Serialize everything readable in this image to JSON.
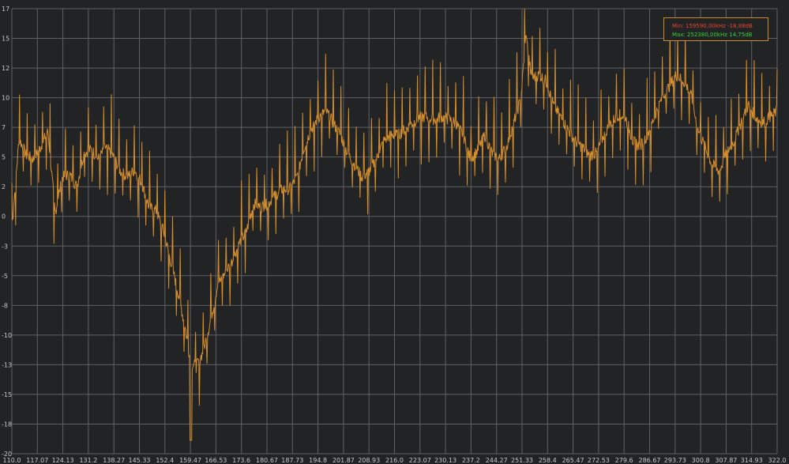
{
  "chart_data": {
    "type": "line",
    "xlim": [
      110.0,
      322.0
    ],
    "ylim": [
      -20,
      17
    ],
    "grid": true,
    "colors": {
      "background": "#222325",
      "grid": "#5f6166",
      "line": "#d8902c",
      "min_text": "#e8442a",
      "max_text": "#39d33a"
    },
    "x_tick_labels": [
      "110.0",
      "117.07",
      "124.13",
      "131.2",
      "138.27",
      "145.33",
      "152.4",
      "159.47",
      "166.53",
      "173.6",
      "180.67",
      "187.73",
      "194.8",
      "201.87",
      "208.93",
      "216.0",
      "223.07",
      "230.13",
      "237.2",
      "244.27",
      "251.33",
      "258.4",
      "265.47",
      "272.53",
      "279.6",
      "286.67",
      "293.73",
      "300.8",
      "307.87",
      "314.93",
      "322.0"
    ],
    "y_tick_labels": [
      "17",
      "15",
      "12",
      "10",
      "7",
      "5",
      "2",
      "0",
      "-3",
      "-5",
      "-8",
      "-10",
      "-13",
      "-15",
      "-18",
      "-20"
    ],
    "min_label": "Min: 159590,00kHz -18,88dB",
    "max_label": "Max: 252380,00kHz 14,75dB",
    "series": [
      {
        "values_x": [
          110.0,
          112.0,
          114.0,
          116.0,
          118.0,
          120.0,
          122.0,
          124.0,
          126.0,
          128.0,
          130.0,
          132.0,
          134.0,
          136.0,
          138.0,
          140.0,
          142.0,
          144.0,
          146.0,
          148.0,
          150.0,
          152.0,
          154.0,
          156.0,
          158.0,
          159.6,
          161.0,
          163.0,
          165.0,
          167.0,
          169.0,
          171.0,
          173.0,
          175.0,
          177.0,
          179.0,
          181.0,
          183.0,
          185.0,
          187.0,
          189.0,
          191.0,
          193.0,
          195.0,
          197.0,
          199.0,
          201.0,
          203.0,
          205.0,
          207.0,
          209.0,
          211.0,
          213.0,
          215.0,
          217.0,
          219.0,
          221.0,
          223.0,
          225.0,
          227.0,
          229.0,
          231.0,
          233.0,
          235.0,
          237.0,
          239.0,
          241.0,
          243.0,
          245.0,
          247.0,
          249.0,
          251.0,
          252.4,
          254.0,
          256.0,
          258.0,
          260.0,
          262.0,
          264.0,
          266.0,
          268.0,
          270.0,
          272.0,
          274.0,
          276.0,
          278.0,
          280.0,
          282.0,
          284.0,
          286.0,
          288.0,
          290.0,
          292.0,
          294.0,
          296.0,
          298.0,
          300.0,
          302.0,
          304.0,
          306.0,
          308.0,
          310.0,
          312.0,
          314.0,
          316.0,
          318.0,
          320.0,
          322.0
        ],
        "values_y": [
          -1.2,
          6.2,
          4.8,
          4.5,
          5.5,
          6.8,
          0.0,
          3.0,
          3.2,
          2.2,
          5.0,
          5.3,
          4.5,
          5.5,
          4.8,
          3.5,
          3.0,
          3.6,
          2.5,
          0.5,
          0.2,
          -1.5,
          -4.0,
          -6.5,
          -9.5,
          -12.5,
          -12.8,
          -11.5,
          -9.0,
          -6.0,
          -5.0,
          -4.0,
          -2.5,
          -1.5,
          0.8,
          0.5,
          0.8,
          1.5,
          2.0,
          2.0,
          3.0,
          5.5,
          7.0,
          8.0,
          8.5,
          7.5,
          6.5,
          5.0,
          4.0,
          3.0,
          3.5,
          4.5,
          6.0,
          6.5,
          6.5,
          7.0,
          7.5,
          8.0,
          8.0,
          7.8,
          8.0,
          7.8,
          7.5,
          6.5,
          4.5,
          5.2,
          6.5,
          5.0,
          4.5,
          5.5,
          7.5,
          9.5,
          14.75,
          11.2,
          11.5,
          11.0,
          9.0,
          8.0,
          7.0,
          6.0,
          5.5,
          4.8,
          5.0,
          6.5,
          7.5,
          8.2,
          8.0,
          6.0,
          5.5,
          6.5,
          8.0,
          9.5,
          10.5,
          11.5,
          11.0,
          10.0,
          7.0,
          5.5,
          4.0,
          3.5,
          5.0,
          6.0,
          7.5,
          9.0,
          8.0,
          7.5,
          8.0,
          8.5
        ]
      }
    ]
  }
}
